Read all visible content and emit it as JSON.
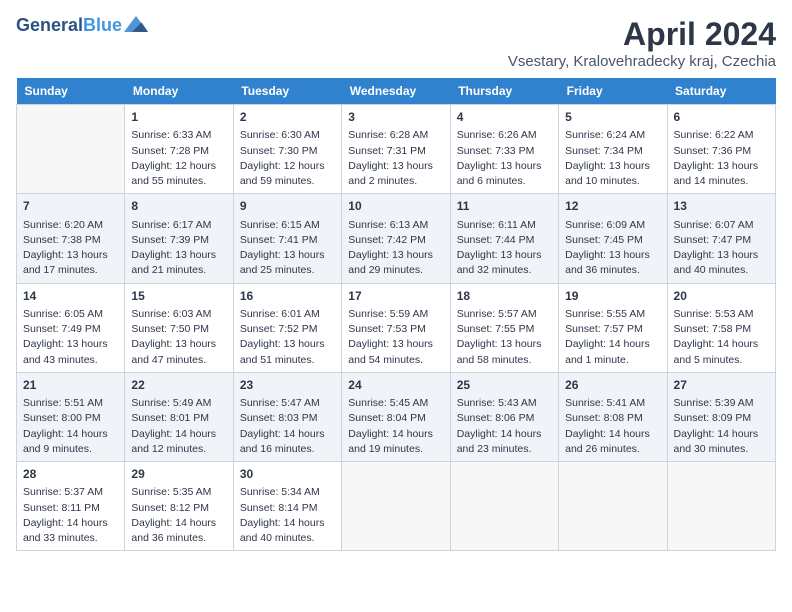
{
  "header": {
    "logo_line1": "General",
    "logo_line2": "Blue",
    "month": "April 2024",
    "location": "Vsestary, Kralovehradecky kraj, Czechia"
  },
  "weekdays": [
    "Sunday",
    "Monday",
    "Tuesday",
    "Wednesday",
    "Thursday",
    "Friday",
    "Saturday"
  ],
  "weeks": [
    [
      {
        "day": "",
        "sunrise": "",
        "sunset": "",
        "daylight": ""
      },
      {
        "day": "1",
        "sunrise": "Sunrise: 6:33 AM",
        "sunset": "Sunset: 7:28 PM",
        "daylight": "Daylight: 12 hours and 55 minutes."
      },
      {
        "day": "2",
        "sunrise": "Sunrise: 6:30 AM",
        "sunset": "Sunset: 7:30 PM",
        "daylight": "Daylight: 12 hours and 59 minutes."
      },
      {
        "day": "3",
        "sunrise": "Sunrise: 6:28 AM",
        "sunset": "Sunset: 7:31 PM",
        "daylight": "Daylight: 13 hours and 2 minutes."
      },
      {
        "day": "4",
        "sunrise": "Sunrise: 6:26 AM",
        "sunset": "Sunset: 7:33 PM",
        "daylight": "Daylight: 13 hours and 6 minutes."
      },
      {
        "day": "5",
        "sunrise": "Sunrise: 6:24 AM",
        "sunset": "Sunset: 7:34 PM",
        "daylight": "Daylight: 13 hours and 10 minutes."
      },
      {
        "day": "6",
        "sunrise": "Sunrise: 6:22 AM",
        "sunset": "Sunset: 7:36 PM",
        "daylight": "Daylight: 13 hours and 14 minutes."
      }
    ],
    [
      {
        "day": "7",
        "sunrise": "Sunrise: 6:20 AM",
        "sunset": "Sunset: 7:38 PM",
        "daylight": "Daylight: 13 hours and 17 minutes."
      },
      {
        "day": "8",
        "sunrise": "Sunrise: 6:17 AM",
        "sunset": "Sunset: 7:39 PM",
        "daylight": "Daylight: 13 hours and 21 minutes."
      },
      {
        "day": "9",
        "sunrise": "Sunrise: 6:15 AM",
        "sunset": "Sunset: 7:41 PM",
        "daylight": "Daylight: 13 hours and 25 minutes."
      },
      {
        "day": "10",
        "sunrise": "Sunrise: 6:13 AM",
        "sunset": "Sunset: 7:42 PM",
        "daylight": "Daylight: 13 hours and 29 minutes."
      },
      {
        "day": "11",
        "sunrise": "Sunrise: 6:11 AM",
        "sunset": "Sunset: 7:44 PM",
        "daylight": "Daylight: 13 hours and 32 minutes."
      },
      {
        "day": "12",
        "sunrise": "Sunrise: 6:09 AM",
        "sunset": "Sunset: 7:45 PM",
        "daylight": "Daylight: 13 hours and 36 minutes."
      },
      {
        "day": "13",
        "sunrise": "Sunrise: 6:07 AM",
        "sunset": "Sunset: 7:47 PM",
        "daylight": "Daylight: 13 hours and 40 minutes."
      }
    ],
    [
      {
        "day": "14",
        "sunrise": "Sunrise: 6:05 AM",
        "sunset": "Sunset: 7:49 PM",
        "daylight": "Daylight: 13 hours and 43 minutes."
      },
      {
        "day": "15",
        "sunrise": "Sunrise: 6:03 AM",
        "sunset": "Sunset: 7:50 PM",
        "daylight": "Daylight: 13 hours and 47 minutes."
      },
      {
        "day": "16",
        "sunrise": "Sunrise: 6:01 AM",
        "sunset": "Sunset: 7:52 PM",
        "daylight": "Daylight: 13 hours and 51 minutes."
      },
      {
        "day": "17",
        "sunrise": "Sunrise: 5:59 AM",
        "sunset": "Sunset: 7:53 PM",
        "daylight": "Daylight: 13 hours and 54 minutes."
      },
      {
        "day": "18",
        "sunrise": "Sunrise: 5:57 AM",
        "sunset": "Sunset: 7:55 PM",
        "daylight": "Daylight: 13 hours and 58 minutes."
      },
      {
        "day": "19",
        "sunrise": "Sunrise: 5:55 AM",
        "sunset": "Sunset: 7:57 PM",
        "daylight": "Daylight: 14 hours and 1 minute."
      },
      {
        "day": "20",
        "sunrise": "Sunrise: 5:53 AM",
        "sunset": "Sunset: 7:58 PM",
        "daylight": "Daylight: 14 hours and 5 minutes."
      }
    ],
    [
      {
        "day": "21",
        "sunrise": "Sunrise: 5:51 AM",
        "sunset": "Sunset: 8:00 PM",
        "daylight": "Daylight: 14 hours and 9 minutes."
      },
      {
        "day": "22",
        "sunrise": "Sunrise: 5:49 AM",
        "sunset": "Sunset: 8:01 PM",
        "daylight": "Daylight: 14 hours and 12 minutes."
      },
      {
        "day": "23",
        "sunrise": "Sunrise: 5:47 AM",
        "sunset": "Sunset: 8:03 PM",
        "daylight": "Daylight: 14 hours and 16 minutes."
      },
      {
        "day": "24",
        "sunrise": "Sunrise: 5:45 AM",
        "sunset": "Sunset: 8:04 PM",
        "daylight": "Daylight: 14 hours and 19 minutes."
      },
      {
        "day": "25",
        "sunrise": "Sunrise: 5:43 AM",
        "sunset": "Sunset: 8:06 PM",
        "daylight": "Daylight: 14 hours and 23 minutes."
      },
      {
        "day": "26",
        "sunrise": "Sunrise: 5:41 AM",
        "sunset": "Sunset: 8:08 PM",
        "daylight": "Daylight: 14 hours and 26 minutes."
      },
      {
        "day": "27",
        "sunrise": "Sunrise: 5:39 AM",
        "sunset": "Sunset: 8:09 PM",
        "daylight": "Daylight: 14 hours and 30 minutes."
      }
    ],
    [
      {
        "day": "28",
        "sunrise": "Sunrise: 5:37 AM",
        "sunset": "Sunset: 8:11 PM",
        "daylight": "Daylight: 14 hours and 33 minutes."
      },
      {
        "day": "29",
        "sunrise": "Sunrise: 5:35 AM",
        "sunset": "Sunset: 8:12 PM",
        "daylight": "Daylight: 14 hours and 36 minutes."
      },
      {
        "day": "30",
        "sunrise": "Sunrise: 5:34 AM",
        "sunset": "Sunset: 8:14 PM",
        "daylight": "Daylight: 14 hours and 40 minutes."
      },
      {
        "day": "",
        "sunrise": "",
        "sunset": "",
        "daylight": ""
      },
      {
        "day": "",
        "sunrise": "",
        "sunset": "",
        "daylight": ""
      },
      {
        "day": "",
        "sunrise": "",
        "sunset": "",
        "daylight": ""
      },
      {
        "day": "",
        "sunrise": "",
        "sunset": "",
        "daylight": ""
      }
    ]
  ]
}
